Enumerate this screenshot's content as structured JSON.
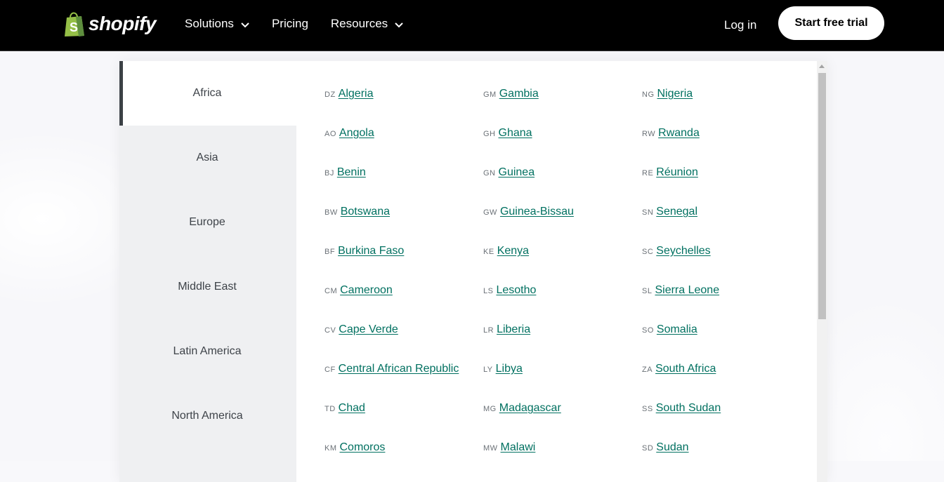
{
  "header": {
    "logo_text": "shopify",
    "brand_color": "#95bf47",
    "nav": [
      {
        "label": "Solutions",
        "has_dropdown": true
      },
      {
        "label": "Pricing",
        "has_dropdown": false
      },
      {
        "label": "Resources",
        "has_dropdown": true
      }
    ],
    "login_label": "Log in",
    "trial_label": "Start free trial"
  },
  "regions": [
    {
      "label": "Africa",
      "active": true
    },
    {
      "label": "Asia",
      "active": false
    },
    {
      "label": "Europe",
      "active": false
    },
    {
      "label": "Middle East",
      "active": false
    },
    {
      "label": "Latin America",
      "active": false
    },
    {
      "label": "North America",
      "active": false
    }
  ],
  "link_color": "#007060",
  "countries": [
    {
      "code": "DZ",
      "name": "Algeria"
    },
    {
      "code": "AO",
      "name": "Angola"
    },
    {
      "code": "BJ",
      "name": "Benin"
    },
    {
      "code": "BW",
      "name": "Botswana"
    },
    {
      "code": "BF",
      "name": "Burkina Faso"
    },
    {
      "code": "CM",
      "name": "Cameroon"
    },
    {
      "code": "CV",
      "name": "Cape Verde"
    },
    {
      "code": "CF",
      "name": "Central African Republic"
    },
    {
      "code": "TD",
      "name": "Chad"
    },
    {
      "code": "KM",
      "name": "Comoros"
    },
    {
      "code": "GM",
      "name": "Gambia"
    },
    {
      "code": "GH",
      "name": "Ghana"
    },
    {
      "code": "GN",
      "name": "Guinea"
    },
    {
      "code": "GW",
      "name": "Guinea-Bissau"
    },
    {
      "code": "KE",
      "name": "Kenya"
    },
    {
      "code": "LS",
      "name": "Lesotho"
    },
    {
      "code": "LR",
      "name": "Liberia"
    },
    {
      "code": "LY",
      "name": "Libya"
    },
    {
      "code": "MG",
      "name": "Madagascar"
    },
    {
      "code": "MW",
      "name": "Malawi"
    },
    {
      "code": "NG",
      "name": "Nigeria"
    },
    {
      "code": "RW",
      "name": "Rwanda"
    },
    {
      "code": "RE",
      "name": "Réunion"
    },
    {
      "code": "SN",
      "name": "Senegal"
    },
    {
      "code": "SC",
      "name": "Seychelles"
    },
    {
      "code": "SL",
      "name": "Sierra Leone"
    },
    {
      "code": "SO",
      "name": "Somalia"
    },
    {
      "code": "ZA",
      "name": "South Africa"
    },
    {
      "code": "SS",
      "name": "South Sudan"
    },
    {
      "code": "SD",
      "name": "Sudan"
    }
  ]
}
